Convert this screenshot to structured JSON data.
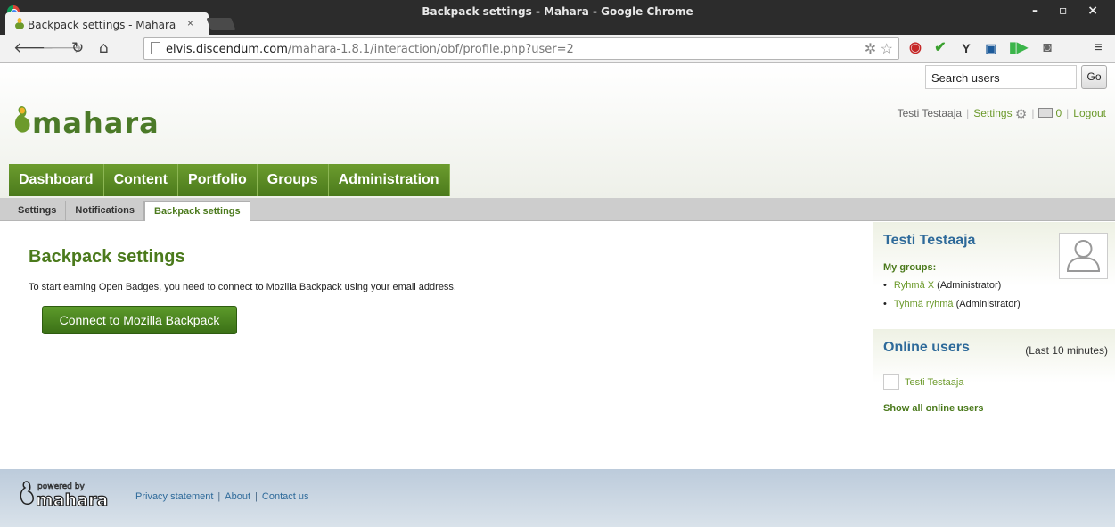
{
  "window": {
    "title": "Backpack settings - Mahara - Google Chrome",
    "controls": "– ▫ ×"
  },
  "tab": {
    "title": "Backpack settings - Mahara",
    "close": "×"
  },
  "address_bar": {
    "host": "elvis.discendum.com",
    "path": "/mahara-1.8.1/interaction/obf/profile.php?user=2"
  },
  "browser_icons": [
    "back-icon",
    "forward-icon",
    "reload-icon",
    "home-icon",
    "star-icon",
    "menu-icon"
  ],
  "extensions": [
    "opera-icon",
    "checkmark-icon",
    "y-icon",
    "camera-icon",
    "id-icon",
    "photo-icon"
  ],
  "header": {
    "logo_text": "mahara",
    "user_name": "Testi Testaaja",
    "settings_label": "Settings",
    "messages_count": "0",
    "logout_label": "Logout",
    "search_placeholder": "Search users",
    "go_label": "Go"
  },
  "main_nav": [
    "Dashboard",
    "Content",
    "Portfolio",
    "Groups",
    "Administration"
  ],
  "sub_nav": {
    "items": [
      "Settings",
      "Notifications",
      "Backpack settings"
    ],
    "active": "Backpack settings"
  },
  "main": {
    "title": "Backpack settings",
    "intro": "To start earning Open Badges, you need to connect to Mozilla Backpack using your email address.",
    "connect_button": "Connect to Mozilla Backpack"
  },
  "sidebar": {
    "profile_name": "Testi Testaaja",
    "my_groups_label": "My groups:",
    "groups": [
      {
        "name": "Ryhmä X",
        "role": "(Administrator)"
      },
      {
        "name": "Tyhmä ryhmä",
        "role": "(Administrator)"
      }
    ],
    "online_title": "Online users",
    "online_meta": "(Last 10 minutes)",
    "online_users": [
      "Testi Testaaja"
    ],
    "show_all": "Show all online users"
  },
  "footer": {
    "powered_by": "powered by",
    "logo_text": "mahara",
    "links": [
      "Privacy statement",
      "About",
      "Contact us"
    ]
  },
  "colors": {
    "mahara_green": "#4b7a1c",
    "link_green": "#6c9a2b",
    "heading_blue": "#2e6a9a",
    "footer_bg": "#c6d3e0"
  }
}
